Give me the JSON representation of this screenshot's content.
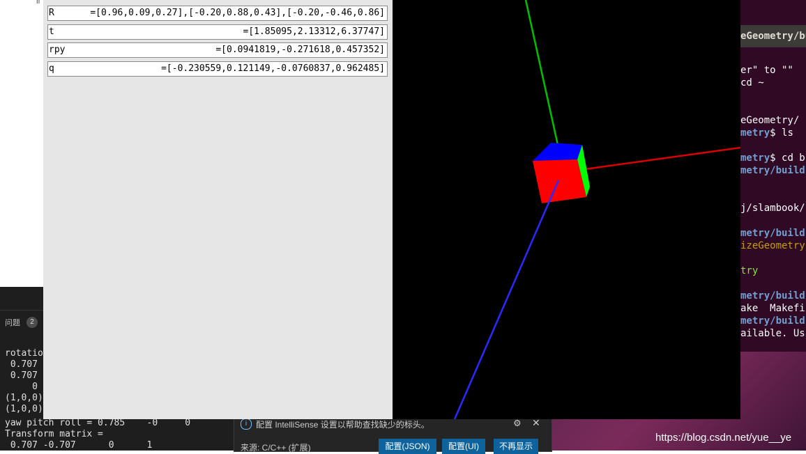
{
  "background": {
    "truncated_top_text": "ll",
    "vscode": {
      "problems_tab": "问题",
      "problems_count": "2",
      "terminal_lines": [
        "rotatio",
        " 0.707",
        " 0.707",
        "     0",
        "(1,0,0)",
        "(1,0,0)"
      ],
      "terminal_bottom_lines": [
        "yaw pitch roll = 0.785    -0     0",
        "Transform matrix =",
        " 0.707 -0.707      0      1"
      ]
    },
    "notification": {
      "message": "配置 IntelliSense 设置以帮助查找缺少的标头。",
      "source": "来源: C/C++ (扩展)",
      "buttons": [
        "配置(JSON)",
        "配置(UI)",
        "不再显示"
      ]
    },
    "ubuntu_terminal": {
      "title": "eGeometry/bu",
      "lines": [
        {
          "text": "er\" to \"\"",
          "style": ""
        },
        {
          "text": "cd ~",
          "style": ""
        },
        {
          "text": "",
          "style": ""
        },
        {
          "text": "",
          "style": ""
        },
        {
          "text": "eGeometry/",
          "style": ""
        },
        {
          "text": "metry$ ls",
          "style": "mixed"
        },
        {
          "text": "",
          "style": ""
        },
        {
          "text": "metry$ cd b",
          "style": "mixed"
        },
        {
          "text": "metry/build",
          "style": "blue"
        },
        {
          "text": "",
          "style": ""
        },
        {
          "text": "",
          "style": ""
        },
        {
          "text": "j/slambook/",
          "style": ""
        },
        {
          "text": "",
          "style": ""
        },
        {
          "text": "metry/build",
          "style": "blue"
        },
        {
          "text": "izeGeometry",
          "style": "ylw"
        },
        {
          "text": "",
          "style": ""
        },
        {
          "text": "try",
          "style": "green"
        },
        {
          "text": "",
          "style": ""
        },
        {
          "text": "metry/build",
          "style": "blue"
        },
        {
          "text": "ake  Makefi",
          "style": ""
        },
        {
          "text": "metry/build",
          "style": "blue"
        },
        {
          "text": "ailable. Us",
          "style": ""
        }
      ]
    },
    "watermark": "https://blog.csdn.net/yue__ye"
  },
  "pangolin": {
    "variables": [
      {
        "name": "R",
        "value": "=[0.96,0.09,0.27],[-0.20,0.88,0.43],[-0.20,-0.46,0.86]"
      },
      {
        "name": "t",
        "value": "=[1.85095,2.13312,6.37747]"
      },
      {
        "name": "rpy",
        "value": "=[0.0941819,-0.271618,0.457352]"
      },
      {
        "name": "q",
        "value": "=[-0.230559,0.121149,-0.0760837,0.962485]"
      }
    ],
    "colors": {
      "x_axis": "#d80000",
      "y_axis": "#00c000",
      "z_axis": "#2a2aff",
      "cube_front": "#ff0000",
      "cube_top": "#0000ff",
      "cube_side": "#00ff00"
    }
  }
}
